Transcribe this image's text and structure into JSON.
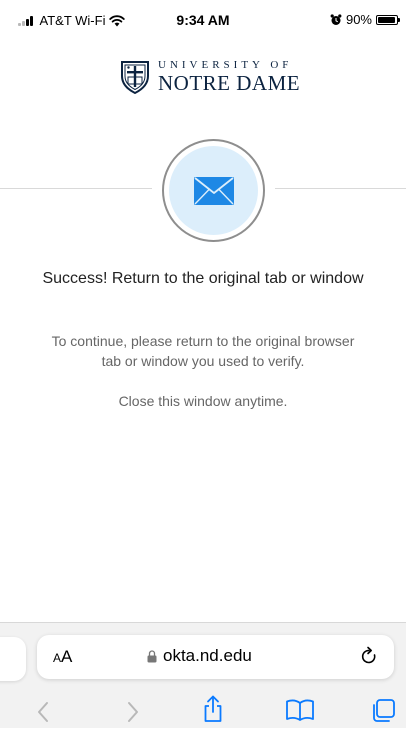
{
  "status_bar": {
    "carrier": "AT&T Wi-Fi",
    "time": "9:34 AM",
    "battery": "90%"
  },
  "logo": {
    "line1": "UNIVERSITY OF",
    "line2": "NOTRE DAME"
  },
  "content": {
    "title": "Success! Return to the original tab or window",
    "instructions": "To continue, please return to the original browser tab or window you used to verify.",
    "close_note": "Close this window anytime."
  },
  "browser": {
    "reader_label_small": "A",
    "reader_label_large": "A",
    "url": "okta.nd.edu"
  },
  "icons": {
    "envelope": "envelope-icon",
    "lock": "lock-icon",
    "reload": "reload-icon",
    "back": "chevron-left-icon",
    "forward": "chevron-right-icon",
    "share": "share-icon",
    "bookmarks": "book-icon",
    "tabs": "tabs-icon"
  },
  "colors": {
    "brand_navy": "#0c2340",
    "envelope_blue": "#1e88e5",
    "icon_bg": "#dceefb",
    "toolbar_blue": "#0a7aff"
  }
}
